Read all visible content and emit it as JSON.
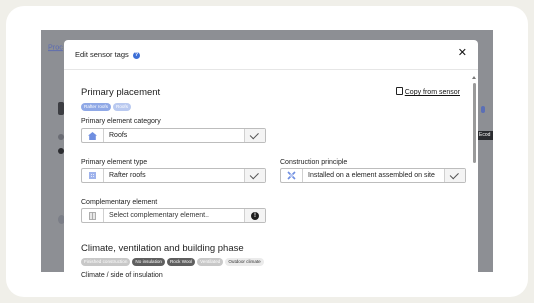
{
  "background": {
    "link_text": "Proc",
    "chip_text": "Ecod"
  },
  "modal": {
    "title": "Edit sensor tags",
    "help_glyph": "?",
    "close_glyph": "✕"
  },
  "primary": {
    "title": "Primary placement",
    "copy_label": "Copy from sensor",
    "tags": [
      "Rafter roofs",
      "Roofs"
    ],
    "category": {
      "label": "Primary element category",
      "value": "Roofs",
      "icon": "house-icon"
    },
    "type": {
      "label": "Primary element type",
      "value": "Rafter roofs",
      "icon": "grid-icon"
    },
    "construction": {
      "label": "Construction principle",
      "value": "Installed on a element assembled on site",
      "icon": "cross-icon"
    },
    "complementary": {
      "label": "Complementary element",
      "placeholder": "Select complementary element..",
      "icon": "wall-icon",
      "info_glyph": "!"
    }
  },
  "climate": {
    "title": "Climate, ventilation and building phase",
    "tags": [
      "Finished construction",
      "No insulation",
      "Rock Wool",
      "Ventilated",
      "Outdoor climate"
    ],
    "subfield_label": "Climate / side of insulation"
  },
  "colors": {
    "accent": "#3d6fd6",
    "tag_blue": "#8fa8e6",
    "tag_dark": "#5f5f5f"
  }
}
